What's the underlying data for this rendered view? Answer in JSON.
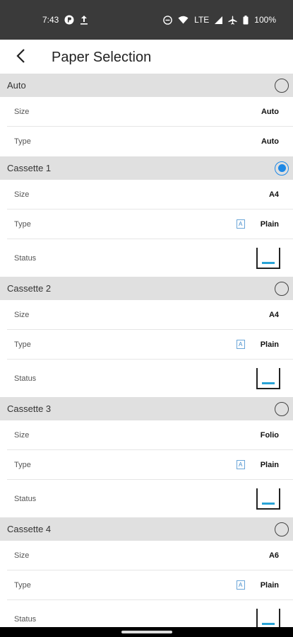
{
  "statusbar": {
    "time": "7:43",
    "network": "LTE",
    "battery": "100%"
  },
  "appbar": {
    "title": "Paper Selection"
  },
  "groups": [
    {
      "name": "Auto",
      "selected": false,
      "size_label": "Size",
      "size": "Auto",
      "type_label": "Type",
      "type": "Auto"
    },
    {
      "name": "Cassette 1",
      "selected": true,
      "size_label": "Size",
      "size": "A4",
      "type_label": "Type",
      "type": "Plain",
      "status_label": "Status"
    },
    {
      "name": "Cassette 2",
      "selected": false,
      "size_label": "Size",
      "size": "A4",
      "type_label": "Type",
      "type": "Plain",
      "status_label": "Status"
    },
    {
      "name": "Cassette 3",
      "selected": false,
      "size_label": "Size",
      "size": "Folio",
      "type_label": "Type",
      "type": "Plain",
      "status_label": "Status"
    },
    {
      "name": "Cassette 4",
      "selected": false,
      "size_label": "Size",
      "size": "A6",
      "type_label": "Type",
      "type": "Plain",
      "status_label": "Status"
    }
  ],
  "paper_type_icon_letter": "A",
  "colors": {
    "accent": "#1e88e5",
    "tray_level": "#29a3d6",
    "header_bg": "#e0e0e0",
    "statusbar_bg": "#3a3a3a"
  }
}
